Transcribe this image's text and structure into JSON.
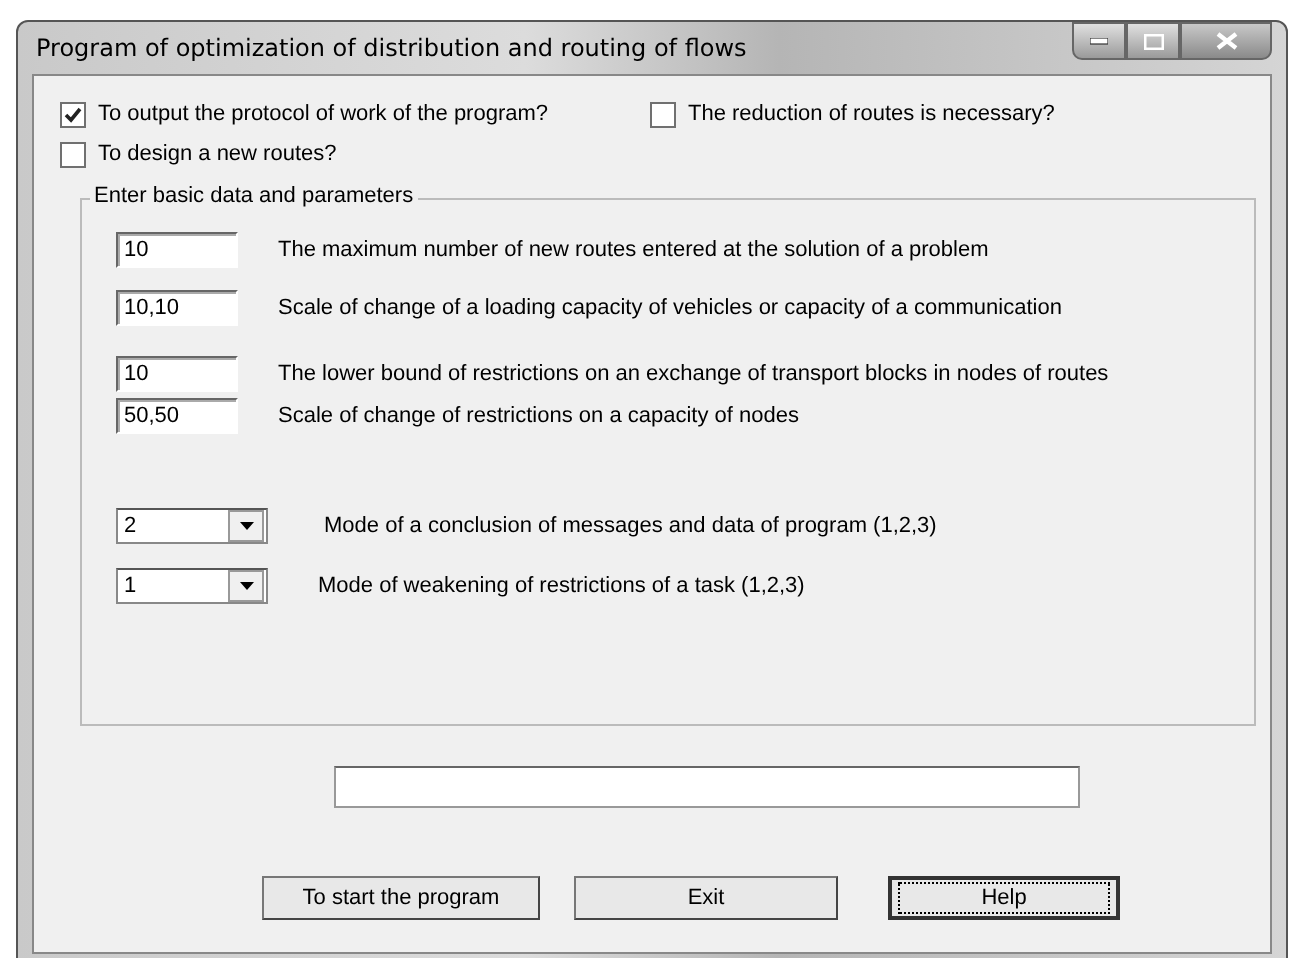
{
  "window": {
    "title": "Program of optimization of distribution and routing of flows"
  },
  "checkboxes": [
    {
      "label": "To output the protocol of work of the program?",
      "checked": true
    },
    {
      "label": "The reduction of routes is necessary?",
      "checked": false
    },
    {
      "label": "To design a new routes?",
      "checked": false
    }
  ],
  "group": {
    "title": "Enter basic data and parameters",
    "params": [
      {
        "kind": "text",
        "value": "10",
        "label": "The maximum number of new routes entered at the solution of a problem"
      },
      {
        "kind": "text",
        "value": "10,10",
        "label": "Scale of change of a loading capacity of vehicles or capacity of a communication"
      },
      {
        "kind": "text",
        "value": "10",
        "label": "The lower bound of restrictions on an exchange of transport blocks in nodes of routes"
      },
      {
        "kind": "text",
        "value": "50,50",
        "label": "Scale of change of restrictions on a capacity of nodes"
      },
      {
        "kind": "combo",
        "value": "2",
        "label": "Mode of a conclusion of messages and data of program (1,2,3)"
      },
      {
        "kind": "combo",
        "value": "1",
        "label": "Mode of weakening of restrictions of a task (1,2,3)"
      }
    ]
  },
  "buttons": [
    {
      "label": "To start the program",
      "focused": false
    },
    {
      "label": "Exit",
      "focused": false
    },
    {
      "label": "Help",
      "focused": true
    }
  ]
}
